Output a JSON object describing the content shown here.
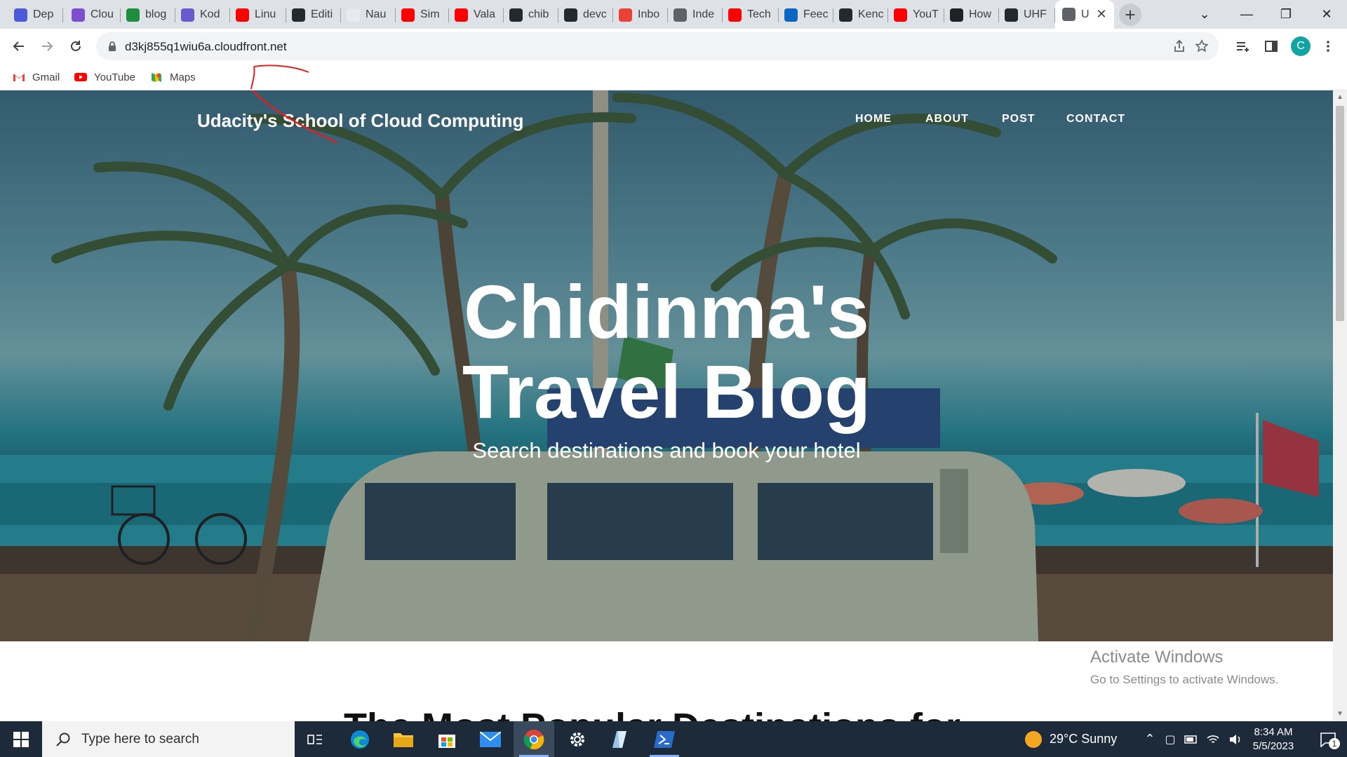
{
  "browser": {
    "tabs": [
      {
        "label": "Dep",
        "icon": "udacity-icon",
        "color": "#4c5ad9"
      },
      {
        "label": "Clou",
        "icon": "cloud-icon",
        "color": "#7c4dcc"
      },
      {
        "label": "blog",
        "icon": "blog-icon",
        "color": "#1e8e3e"
      },
      {
        "label": "Kod",
        "icon": "kodekloud-icon",
        "color": "#6a5acd"
      },
      {
        "label": "Linu",
        "icon": "youtube-icon",
        "color": "#ff0000"
      },
      {
        "label": "Editi",
        "icon": "github-icon",
        "color": "#24292f"
      },
      {
        "label": "Nau",
        "icon": "page-icon",
        "color": "#e8eaed"
      },
      {
        "label": "Sim",
        "icon": "youtube-icon",
        "color": "#ff0000"
      },
      {
        "label": "Vala",
        "icon": "youtube-icon",
        "color": "#ff0000"
      },
      {
        "label": "chib",
        "icon": "github-icon",
        "color": "#24292f"
      },
      {
        "label": "devc",
        "icon": "github-icon",
        "color": "#24292f"
      },
      {
        "label": "Inbo",
        "icon": "gmail-icon",
        "color": "#ea4335"
      },
      {
        "label": "Inde",
        "icon": "info-icon",
        "color": "#5f6368"
      },
      {
        "label": "Tech",
        "icon": "youtube-icon",
        "color": "#ff0000"
      },
      {
        "label": "Feec",
        "icon": "linkedin-icon",
        "color": "#0a66c2"
      },
      {
        "label": "Kenc",
        "icon": "github-icon",
        "color": "#24292f"
      },
      {
        "label": "YouT",
        "icon": "youtube-music-icon",
        "color": "#ff0000"
      },
      {
        "label": "How",
        "icon": "co-icon",
        "color": "#202124"
      },
      {
        "label": "UHF",
        "icon": "github-icon",
        "color": "#24292f"
      },
      {
        "label": "U",
        "icon": "globe-icon",
        "color": "#5f6368",
        "active": true
      }
    ],
    "url": "d3kj855q1wiu6a.cloudfront.net",
    "profile_initial": "C",
    "bookmarks": [
      {
        "label": "Gmail",
        "icon": "gmail-icon"
      },
      {
        "label": "YouTube",
        "icon": "youtube-icon"
      },
      {
        "label": "Maps",
        "icon": "maps-icon"
      }
    ]
  },
  "site": {
    "title": "Udacity's School of Cloud Computing",
    "nav": [
      "HOME",
      "ABOUT",
      "POST",
      "CONTACT"
    ],
    "headline_line1": "Chidinma's",
    "headline_line2": "Travel Blog",
    "subheading": "Search destinations and book your hotel",
    "next_section_title": "The Most Popular Destinations for Solo"
  },
  "watermark": {
    "title": "Activate Windows",
    "subtitle": "Go to Settings to activate Windows."
  },
  "taskbar": {
    "search_placeholder": "Type here to search",
    "weather": "29°C  Sunny",
    "time": "8:34 AM",
    "date": "5/5/2023",
    "notification_count": "1"
  }
}
